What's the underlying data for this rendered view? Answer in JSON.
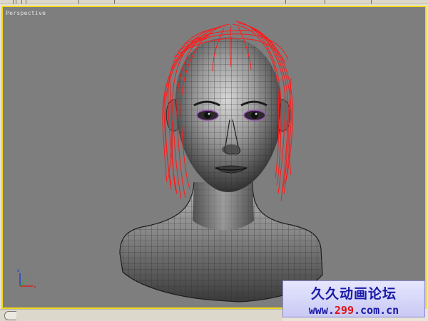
{
  "viewport": {
    "label": "Perspective",
    "border_color": "#f2d81a",
    "background_color": "#7e7e7e"
  },
  "model": {
    "mesh_color": "#5a5a5a",
    "hair_color": "#ff1a1a",
    "eye_color": "#a050c0"
  },
  "axis_gizmo": {
    "x_color": "#d02020",
    "y_color": "#20b020",
    "z_color": "#2040d0"
  },
  "watermark": {
    "title": "久久动画论坛",
    "url_prefix": "www.",
    "url_highlight": "299",
    "url_suffix": ".com.cn"
  },
  "icons": {
    "viewport_nav": "curved-handle-icon"
  }
}
